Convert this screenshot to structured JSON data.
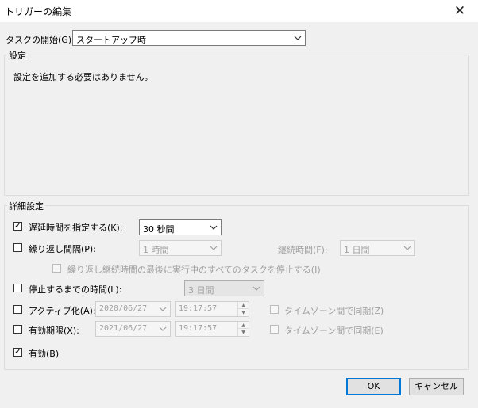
{
  "window": {
    "title": "トリガーの編集",
    "close_glyph": "✕"
  },
  "begin_task": {
    "label": "タスクの開始(G):",
    "value": "スタートアップ時"
  },
  "settings": {
    "label": "設定",
    "message": "設定を追加する必要はありません。"
  },
  "advanced": {
    "label": "詳細設定",
    "delay": {
      "label": "遅延時間を指定する(K):",
      "checked": true,
      "value": "30 秒間"
    },
    "repeat": {
      "label": "繰り返し間隔(P):",
      "checked": false,
      "value": "1 時間",
      "duration_label": "継続時間(F):",
      "duration_value": "1 日間",
      "stop_all_label": "繰り返し継続時間の最後に実行中のすべてのタスクを停止する(I)"
    },
    "stop_after": {
      "label": "停止するまでの時間(L):",
      "checked": false,
      "value": "3 日間"
    },
    "activate": {
      "label": "アクティブ化(A):",
      "checked": false,
      "date": "2020/06/27",
      "time": "19:17:57",
      "sync_label": "タイムゾーン間で同期(Z)"
    },
    "expire": {
      "label": "有効期限(X):",
      "checked": false,
      "date": "2021/06/27",
      "time": "19:17:57",
      "sync_label": "タイムゾーン間で同期(E)"
    },
    "enabled": {
      "label": "有効(B)",
      "checked": true
    }
  },
  "buttons": {
    "ok": "OK",
    "cancel": "キャンセル"
  }
}
